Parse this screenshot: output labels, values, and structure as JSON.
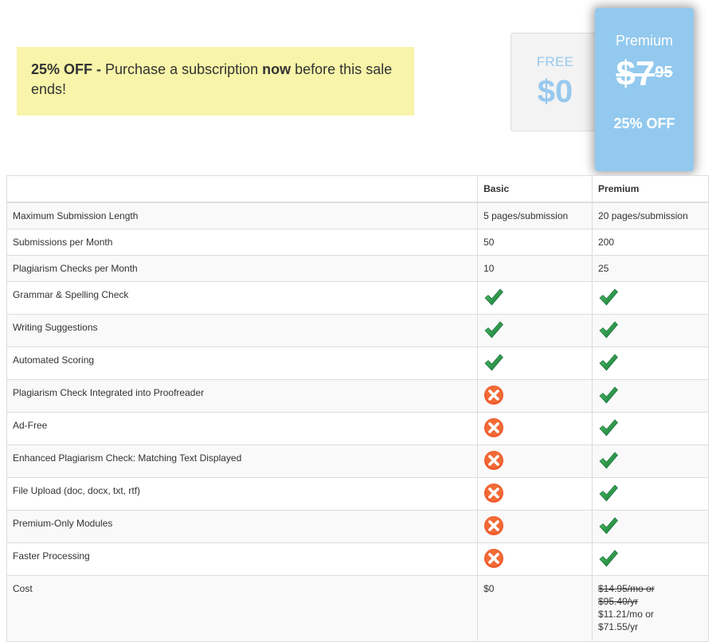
{
  "banner": {
    "discount": "25% OFF",
    "separator": " - ",
    "text_before": "Purchase a subscription ",
    "emphasis": "now",
    "text_after": " before this sale ends!",
    "background_color": "#f8f4a9"
  },
  "plans": {
    "free": {
      "name": "FREE",
      "price": "$0",
      "text_color": "#97c9ef"
    },
    "premium": {
      "name": "Premium",
      "price_dollars": "$7",
      "price_cents": "95",
      "discount": "25% OFF",
      "background_color": "#93c9ee"
    }
  },
  "table": {
    "headers": [
      "",
      "Basic",
      "Premium"
    ],
    "rows": [
      {
        "feature": "Maximum Submission Length",
        "basic": "5 pages/submission",
        "premium": "20 pages/submission",
        "type": "text"
      },
      {
        "feature": "Submissions per Month",
        "basic": "50",
        "premium": "200",
        "type": "text"
      },
      {
        "feature": "Plagiarism Checks per Month",
        "basic": "10",
        "premium": "25",
        "type": "text"
      },
      {
        "feature": "Grammar & Spelling Check",
        "basic": "check",
        "premium": "check",
        "type": "icon"
      },
      {
        "feature": "Writing Suggestions",
        "basic": "check",
        "premium": "check",
        "type": "icon"
      },
      {
        "feature": "Automated Scoring",
        "basic": "check",
        "premium": "check",
        "type": "icon"
      },
      {
        "feature": "Plagiarism Check Integrated into Proofreader",
        "basic": "cross",
        "premium": "check",
        "type": "icon"
      },
      {
        "feature": "Ad-Free",
        "basic": "cross",
        "premium": "check",
        "type": "icon"
      },
      {
        "feature": "Enhanced Plagiarism Check: Matching Text Displayed",
        "basic": "cross",
        "premium": "check",
        "type": "icon"
      },
      {
        "feature": "File Upload (doc, docx, txt, rtf)",
        "basic": "cross",
        "premium": "check",
        "type": "icon"
      },
      {
        "feature": "Premium-Only Modules",
        "basic": "cross",
        "premium": "check",
        "type": "icon"
      },
      {
        "feature": "Faster Processing",
        "basic": "cross",
        "premium": "check",
        "type": "icon"
      }
    ],
    "cost": {
      "feature": "Cost",
      "basic": "$0",
      "premium_old_monthly": "$14.95/mo or",
      "premium_old_yearly": "$95.40/yr",
      "premium_new_monthly": "$11.21/mo or",
      "premium_new_yearly": "$71.55/yr"
    }
  },
  "icons": {
    "check": {
      "semantic": "green-checkmark-icon",
      "color": "#2e9e44"
    },
    "cross": {
      "semantic": "red-x-circle-icon",
      "color": "#ef5a2a"
    }
  }
}
